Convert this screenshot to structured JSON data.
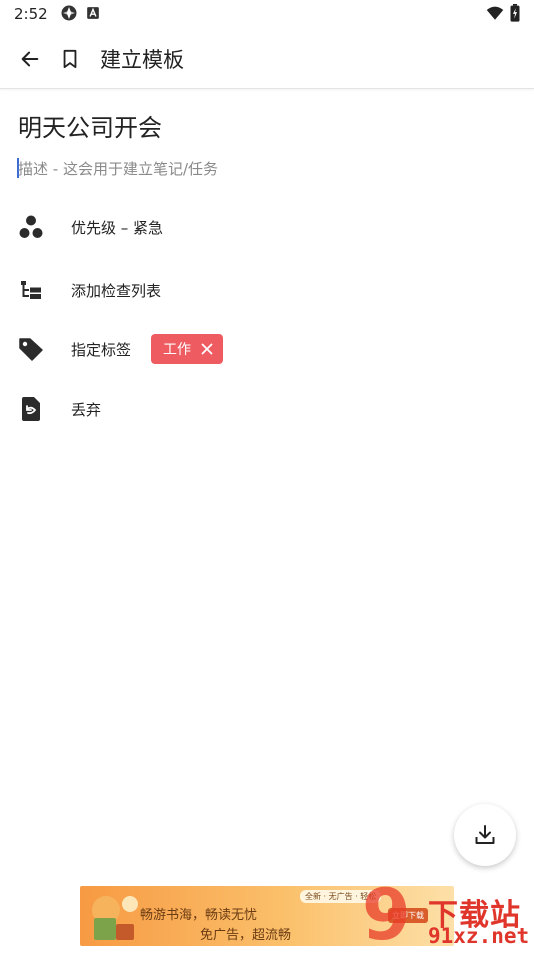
{
  "status_bar": {
    "time": "2:52"
  },
  "toolbar": {
    "title": "建立模板"
  },
  "note": {
    "title": "明天公司开会",
    "description_placeholder": "描述 - 这会用于建立笔记/任务",
    "description_value": ""
  },
  "options": {
    "priority_label": "优先级 – 紧急",
    "checklist_label": "添加检查列表",
    "tag_label": "指定标签",
    "tag_chip": "工作",
    "discard_label": "丢弃"
  },
  "ad": {
    "line1": "畅游书海，畅读无忧",
    "line2": "免广告，超流畅",
    "mini_text": "全新 · 无广告 · 轻松",
    "button": "立即下载"
  },
  "watermark": {
    "number": "9",
    "cn": "下载站",
    "url": "91xz.net"
  },
  "colors": {
    "tag_bg": "#ee5b61",
    "icon": "#2b2b2b",
    "caret": "#3a6cd6"
  },
  "icons": [
    "back-arrow-icon",
    "bookmark-icon",
    "priority-dots-icon",
    "checklist-tree-icon",
    "tag-icon",
    "discard-file-icon",
    "close-icon",
    "download-icon"
  ]
}
